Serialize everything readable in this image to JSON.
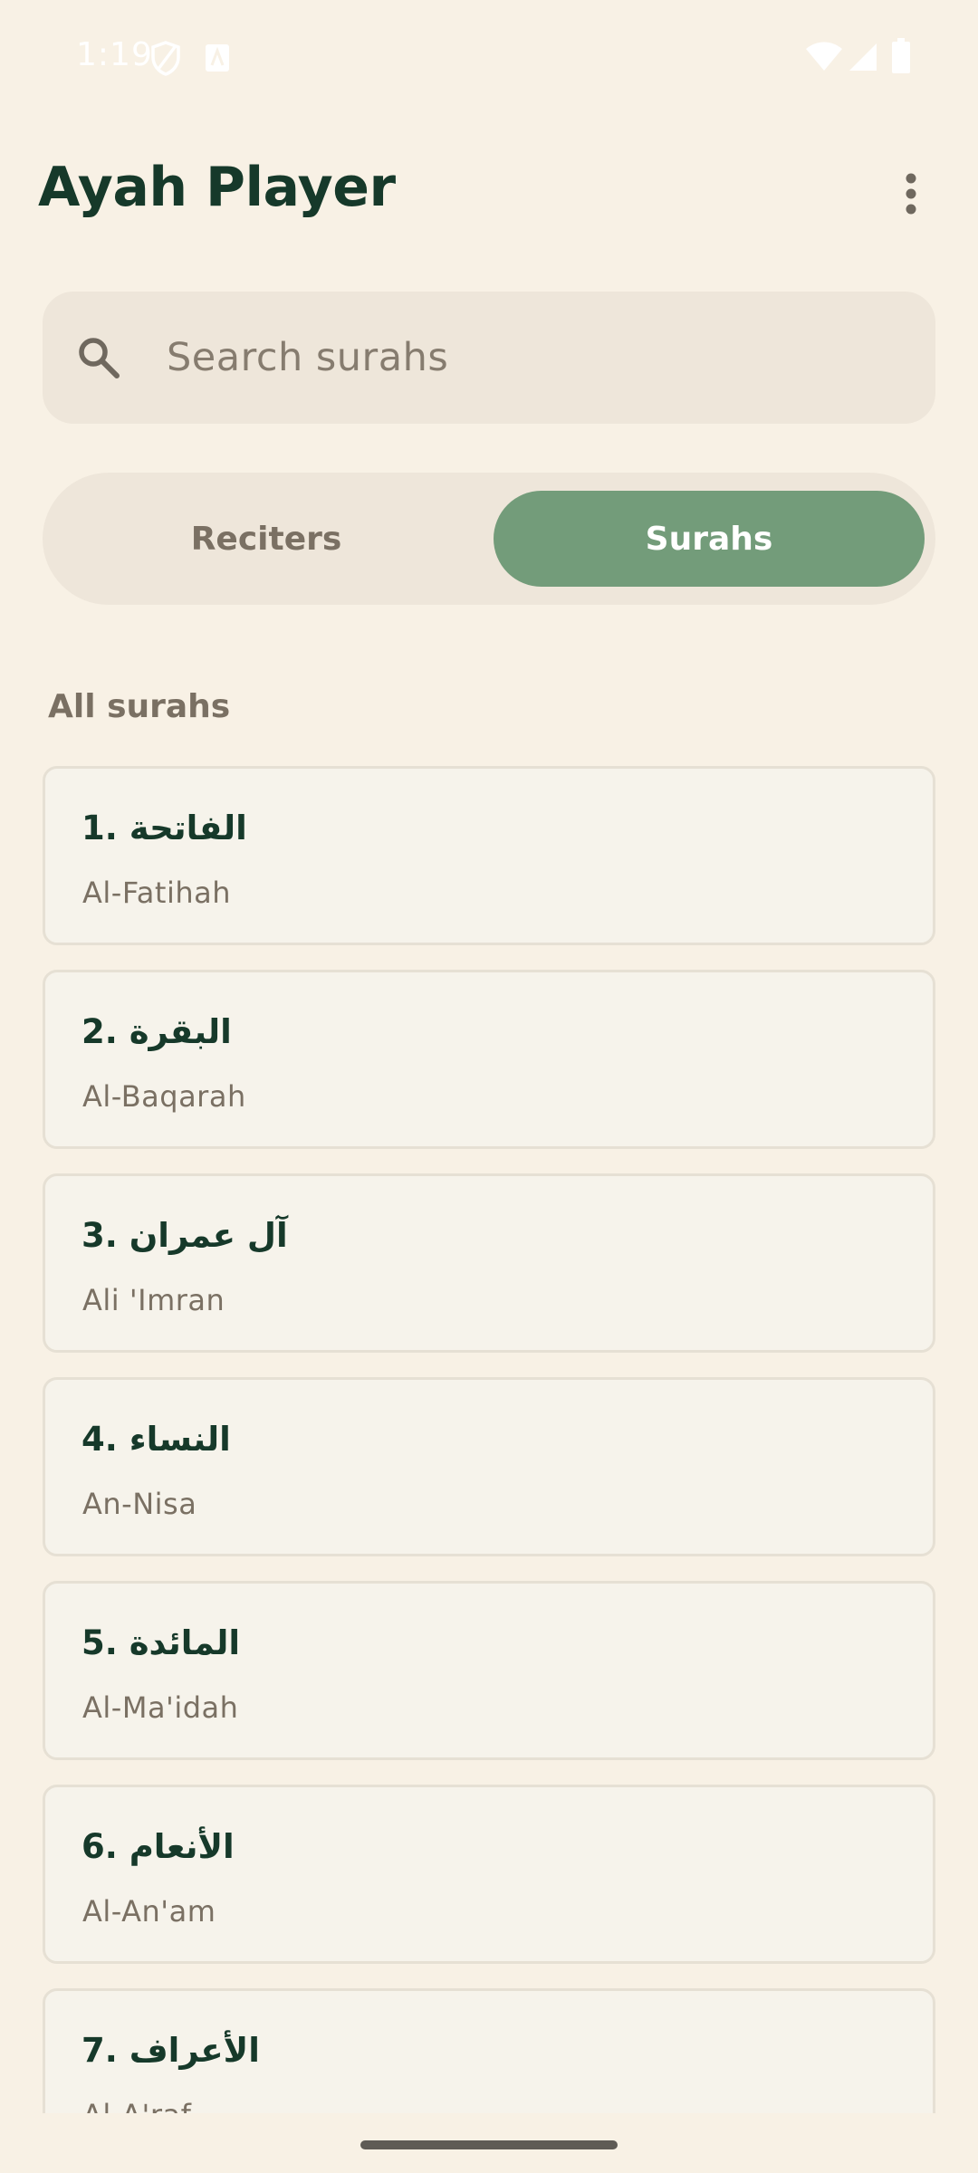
{
  "status_bar": {
    "time": "1:19",
    "icons": [
      "shield-icon",
      "text-badge-icon",
      "wifi-icon",
      "cellular-signal-icon",
      "battery-icon"
    ]
  },
  "app_bar": {
    "title": "Ayah Player",
    "menu_icon": "more-vert-icon"
  },
  "search": {
    "icon": "search-icon",
    "placeholder": "Search surahs"
  },
  "tabs": [
    {
      "label": "Reciters",
      "selected": false
    },
    {
      "label": "Surahs",
      "selected": true
    }
  ],
  "section_label": "All surahs",
  "surahs": [
    {
      "title": "1. الفاتحة",
      "name": "Al-Fatihah"
    },
    {
      "title": "2. البقرة",
      "name": "Al-Baqarah"
    },
    {
      "title": "3. آل عمران",
      "name": "Ali 'Imran"
    },
    {
      "title": "4. النساء",
      "name": "An-Nisa"
    },
    {
      "title": "5. المائدة",
      "name": "Al-Ma'idah"
    },
    {
      "title": "6. الأنعام",
      "name": "Al-An'am"
    },
    {
      "title": "7. الأعراف",
      "name": "Al-A'raf"
    }
  ],
  "colors": {
    "background": "#F8F1E5",
    "surface": "#EEE6DA",
    "card": "#F6F3EB",
    "accent": "#739C7A",
    "title_text": "#16392A",
    "muted_text": "#7A7063"
  }
}
